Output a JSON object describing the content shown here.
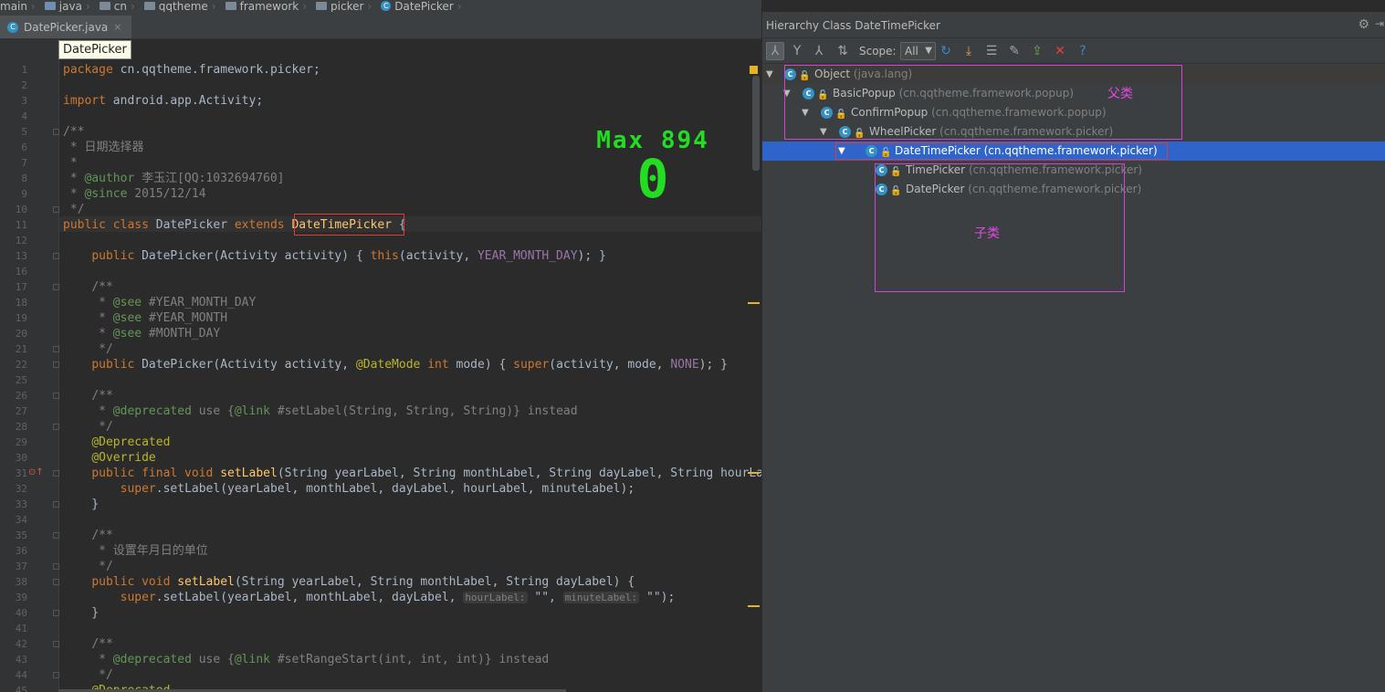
{
  "breadcrumb": [
    "main",
    "java",
    "cn",
    "qqtheme",
    "framework",
    "picker",
    "DatePicker"
  ],
  "tab": {
    "label": "DatePicker.java",
    "close": "×"
  },
  "tooltip": "DatePicker",
  "overlay": {
    "max": "Max 894",
    "value": "0"
  },
  "code_lines": [
    {
      "n": "1",
      "html": "<span class='kw'>package</span> cn.qqtheme.framework.picker;"
    },
    {
      "n": "2",
      "html": ""
    },
    {
      "n": "3",
      "html": "<span class='kw'>import</span> android.app.Activity;"
    },
    {
      "n": "4",
      "html": ""
    },
    {
      "n": "5",
      "html": "<span class='cm'>/**</span>"
    },
    {
      "n": "6",
      "html": "<span class='cm'> * 日期选择器</span>"
    },
    {
      "n": "7",
      "html": "<span class='cm'> *</span>"
    },
    {
      "n": "8",
      "html": "<span class='cm'> * </span><span class='doc'>@author</span><span class='cm'> 李玉江[QQ:1032694760]</span>"
    },
    {
      "n": "9",
      "html": "<span class='cm'> * </span><span class='doc'>@since</span><span class='cm'> 2015/12/14</span>"
    },
    {
      "n": "10",
      "html": "<span class='cm'> */</span>"
    },
    {
      "n": "11",
      "html": "<span class='kw'>public class</span> DatePicker <span class='kw'>extends</span> <span class='fn'>DateTimePicker</span> {"
    },
    {
      "n": "12",
      "html": ""
    },
    {
      "n": "13",
      "html": "    <span class='kw'>public</span> DatePicker(Activity activity) { <span class='kw'>this</span>(activity, <span class='cn'>YEAR_MONTH_DAY</span>); }"
    },
    {
      "n": "16",
      "html": ""
    },
    {
      "n": "17",
      "html": "    <span class='cm'>/**</span>"
    },
    {
      "n": "18",
      "html": "    <span class='cm'> * </span><span class='doc'>@see</span><span class='cm'> #YEAR_MONTH_DAY</span>"
    },
    {
      "n": "19",
      "html": "    <span class='cm'> * </span><span class='doc'>@see</span><span class='cm'> #YEAR_MONTH</span>"
    },
    {
      "n": "20",
      "html": "    <span class='cm'> * </span><span class='doc'>@see</span><span class='cm'> #MONTH_DAY</span>"
    },
    {
      "n": "21",
      "html": "    <span class='cm'> */</span>"
    },
    {
      "n": "22",
      "html": "    <span class='kw'>public</span> DatePicker(Activity activity, <span class='an'>@DateMode</span> <span class='kw'>int</span> mode) { <span class='kw'>super</span>(activity, mode, <span class='cn'>NONE</span>); }"
    },
    {
      "n": "25",
      "html": ""
    },
    {
      "n": "26",
      "html": "    <span class='cm'>/**</span>"
    },
    {
      "n": "27",
      "html": "    <span class='cm'> * </span><span class='doc'>@deprecated</span><span class='cm'> use {</span><span class='doc'>@link</span><span class='cm'> #setLabel(String, String, String)} instead</span>"
    },
    {
      "n": "28",
      "html": "    <span class='cm'> */</span>"
    },
    {
      "n": "29",
      "html": "    <span class='an'>@Deprecated</span>"
    },
    {
      "n": "30",
      "html": "    <span class='an'>@Override</span>"
    },
    {
      "n": "31",
      "html": "    <span class='kw'>public final void</span> <span class='fn'>setLabel</span>(String yearLabel, String monthLabel, String dayLabel, String hourLabel"
    },
    {
      "n": "32",
      "html": "        <span class='kw'>super</span>.setLabel(yearLabel, monthLabel, dayLabel, hourLabel, minuteLabel);"
    },
    {
      "n": "33",
      "html": "    }"
    },
    {
      "n": "34",
      "html": ""
    },
    {
      "n": "35",
      "html": "    <span class='cm'>/**</span>"
    },
    {
      "n": "36",
      "html": "    <span class='cm'> * 设置年月日的单位</span>"
    },
    {
      "n": "37",
      "html": "    <span class='cm'> */</span>"
    },
    {
      "n": "38",
      "html": "    <span class='kw'>public void</span> <span class='fn'>setLabel</span>(String yearLabel, String monthLabel, String dayLabel) {"
    },
    {
      "n": "39",
      "html": "        <span class='kw'>super</span>.setLabel(yearLabel, monthLabel, dayLabel, <span class='hint'>hourLabel:</span> \"\", <span class='hint'>minuteLabel:</span> \"\");"
    },
    {
      "n": "40",
      "html": "    }"
    },
    {
      "n": "41",
      "html": ""
    },
    {
      "n": "42",
      "html": "    <span class='cm'>/**</span>"
    },
    {
      "n": "43",
      "html": "    <span class='cm'> * </span><span class='doc'>@deprecated</span><span class='cm'> use {</span><span class='doc'>@link</span><span class='cm'> #setRangeStart(int, int, int)} instead</span>"
    },
    {
      "n": "44",
      "html": "    <span class='cm'> */</span>"
    },
    {
      "n": "45",
      "html": "    <span class='an'>@Deprecated</span>"
    }
  ],
  "panel": {
    "title": "Hierarchy Class DateTimePicker",
    "scope_label": "Scope:",
    "scope_value": "All",
    "tree": [
      {
        "name": "Object",
        "pkg": "(java.lang)"
      },
      {
        "name": "BasicPopup",
        "pkg": "(cn.qqtheme.framework.popup)"
      },
      {
        "name": "ConfirmPopup",
        "pkg": "(cn.qqtheme.framework.popup)"
      },
      {
        "name": "WheelPicker",
        "pkg": "(cn.qqtheme.framework.picker)"
      },
      {
        "name": "DateTimePicker",
        "pkg": "(cn.qqtheme.framework.picker)"
      },
      {
        "name": "TimePicker",
        "pkg": "(cn.qqtheme.framework.picker)"
      },
      {
        "name": "DatePicker",
        "pkg": "(cn.qqtheme.framework.picker)"
      }
    ],
    "annotation_parent": "父类",
    "annotation_child": "子类"
  }
}
